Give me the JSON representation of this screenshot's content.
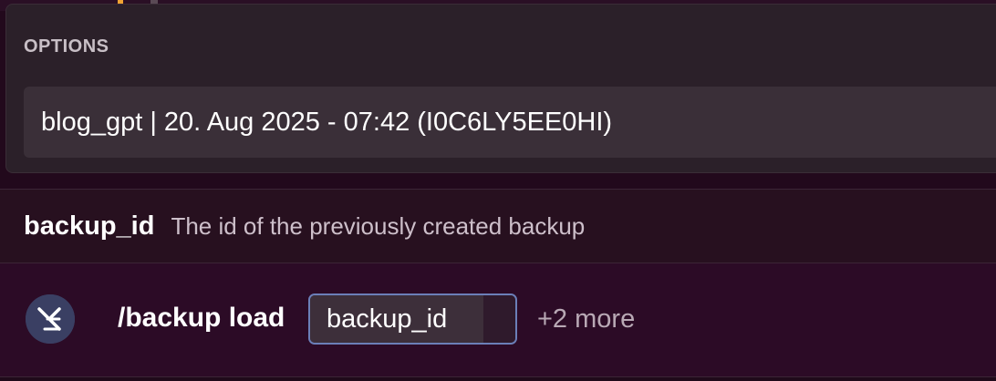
{
  "options_popup": {
    "heading": "OPTIONS",
    "items": [
      {
        "label": "blog_gpt | 20. Aug 2025 - 07:42 (I0C6LY5EE0HI)"
      }
    ]
  },
  "param_hint": {
    "name": "backup_id",
    "description": "The id of the previously created backup"
  },
  "command_bar": {
    "command": "/backup load",
    "active_option": "backup_id",
    "more_label": "+2 more",
    "app_icon": "app-avatar-icon"
  },
  "colors": {
    "background": "#22091c",
    "popup": "#2b2029",
    "option_item": "#3a2f38",
    "pill_border": "#6b7fb8",
    "accent_orange": "#f0a332"
  }
}
